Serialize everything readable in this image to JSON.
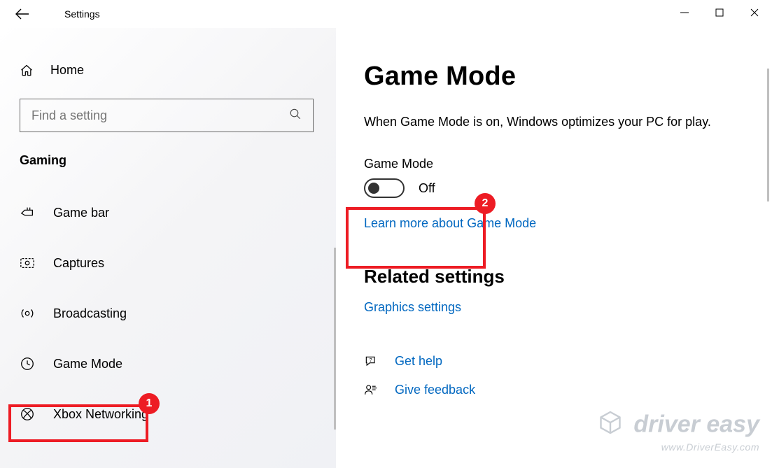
{
  "window": {
    "title": "Settings"
  },
  "sidebar": {
    "home": "Home",
    "search_placeholder": "Find a setting",
    "category": "Gaming",
    "items": [
      {
        "label": "Game bar"
      },
      {
        "label": "Captures"
      },
      {
        "label": "Broadcasting"
      },
      {
        "label": "Game Mode"
      },
      {
        "label": "Xbox Networking"
      }
    ]
  },
  "main": {
    "title": "Game Mode",
    "description": "When Game Mode is on, Windows optimizes your PC for play.",
    "toggle": {
      "label": "Game Mode",
      "state": "Off"
    },
    "learn_more": "Learn more about Game Mode",
    "related_title": "Related settings",
    "graphics_link": "Graphics settings",
    "help": "Get help",
    "feedback": "Give feedback"
  },
  "annotations": {
    "badge1": "1",
    "badge2": "2"
  },
  "watermark": {
    "brand": "driver easy",
    "url": "www.DriverEasy.com"
  }
}
